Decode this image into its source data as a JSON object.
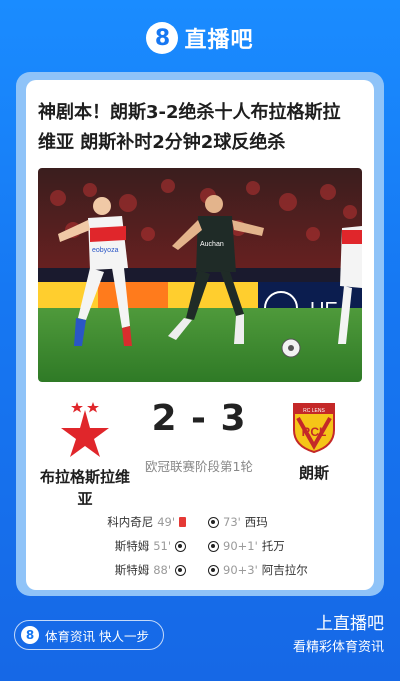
{
  "header": {
    "logo_symbol": "8",
    "logo_text": "直播吧"
  },
  "article": {
    "headline_line1": "神剧本！朗斯3-2绝杀十人布拉格斯拉",
    "headline_line2": "维亚 朗斯补时2分钟2球反绝杀"
  },
  "match": {
    "home_team": {
      "name_line1": "布拉格斯拉维",
      "name_line2": "亚",
      "crest": "slavia-star-crest"
    },
    "away_team": {
      "name": "朗斯",
      "crest": "rcl-shield-crest"
    },
    "score": "2 - 3",
    "competition": "欧冠联赛阶段第1轮"
  },
  "events": [
    {
      "home_player": "科内奇尼",
      "home_minute": "49'",
      "home_icon": "red-card-icon",
      "away_icon": "ball-icon",
      "away_minute": "73'",
      "away_player": "西玛"
    },
    {
      "home_player": "斯特姆",
      "home_minute": "51'",
      "home_icon": "ball-icon",
      "away_icon": "ball-icon",
      "away_minute": "90+1'",
      "away_player": "托万"
    },
    {
      "home_player": "斯特姆",
      "home_minute": "88'",
      "home_icon": "ball-icon",
      "away_icon": "ball-icon",
      "away_minute": "90+3'",
      "away_player": "阿吉拉尔"
    }
  ],
  "photo": {
    "sponsor_text": "Auchan",
    "jersey_text": "eobyoza",
    "board_text": "UE"
  },
  "footer": {
    "pill_logo": "8",
    "pill_text": "体育资讯 快人一步",
    "line1": "上直播吧",
    "line2": "看精彩体育资讯"
  },
  "colors": {
    "brand_blue": "#1677f2",
    "red_card": "#e53935",
    "slavia_red": "#e0262b",
    "lens_yellow": "#f5c518"
  }
}
